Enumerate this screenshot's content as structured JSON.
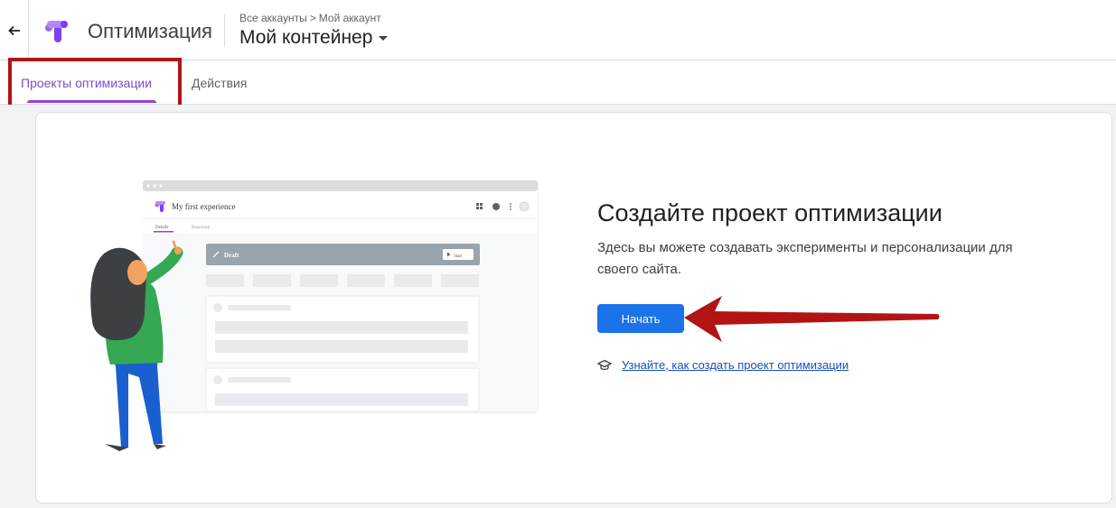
{
  "header": {
    "back_icon": "arrow-left-icon",
    "product_name": "Оптимизация",
    "breadcrumb": {
      "all_accounts": "Все аккаунты",
      "separator": ">",
      "my_account": "Мой аккаунт"
    },
    "container_name": "Мой контейнер"
  },
  "tabs": [
    {
      "label": "Проекты оптимизации",
      "active": true
    },
    {
      "label": "Действия",
      "active": false
    }
  ],
  "empty_state": {
    "title": "Создайте проект оптимизации",
    "description": "Здесь вы можете создавать эксперименты и персонализации для своего сайта.",
    "start_button": "Начать",
    "learn_link": "Узнайте, как создать проект оптимизации",
    "learn_icon": "graduation-cap-icon"
  },
  "illustration": {
    "window_title": "My first experience",
    "tab_details": "Details",
    "tab_reporting": "Reporting",
    "draft_label": "Draft",
    "start_label": "Start"
  },
  "colors": {
    "accent_purple": "#8e44d4",
    "primary_blue": "#1a73e8",
    "annotation_red": "#b21414"
  }
}
